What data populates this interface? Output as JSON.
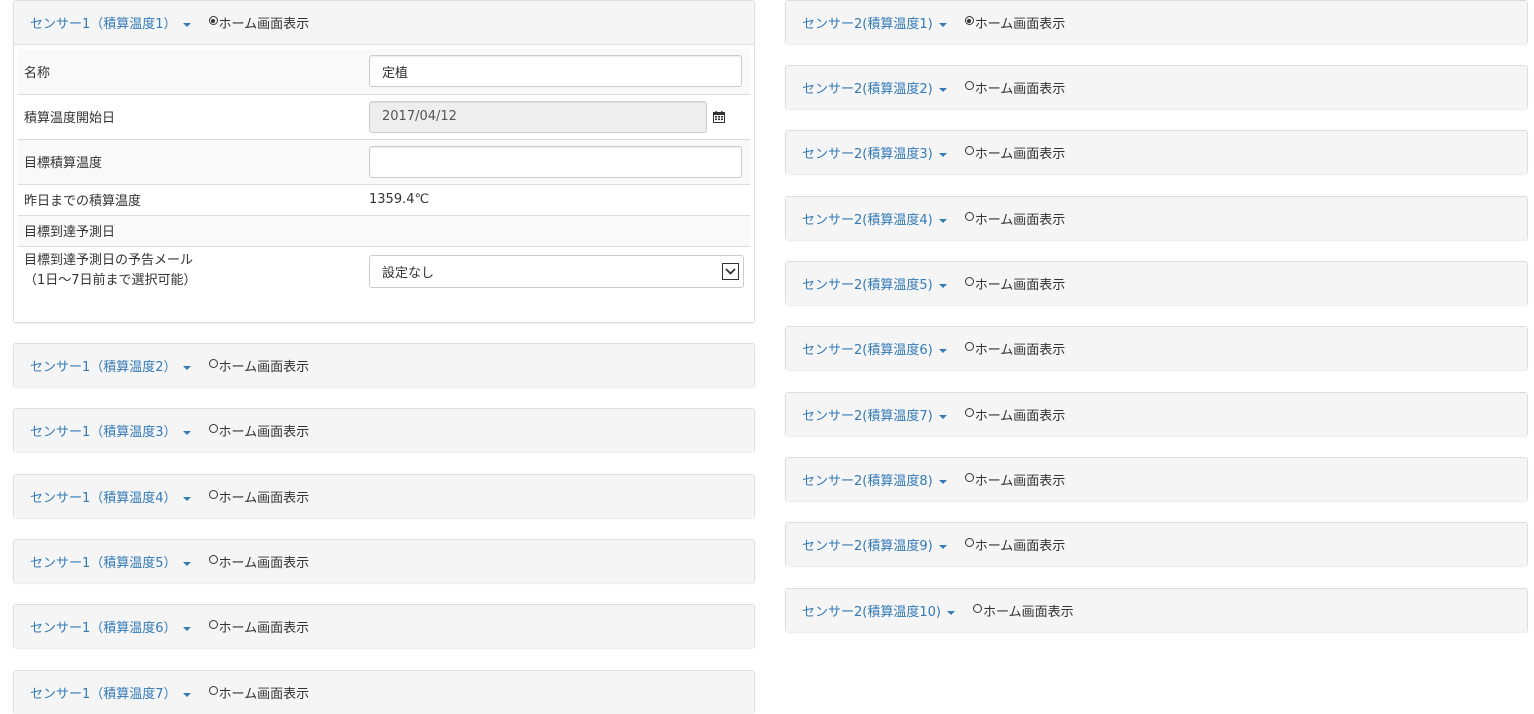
{
  "radio_label": "ホーム画面表示",
  "sensor1": {
    "panels": [
      {
        "title": "センサー1（積算温度1）",
        "checked": true
      },
      {
        "title": "センサー1（積算温度2）",
        "checked": false
      },
      {
        "title": "センサー1（積算温度3）",
        "checked": false
      },
      {
        "title": "センサー1（積算温度4）",
        "checked": false
      },
      {
        "title": "センサー1（積算温度5）",
        "checked": false
      },
      {
        "title": "センサー1（積算温度6）",
        "checked": false
      },
      {
        "title": "センサー1（積算温度7）",
        "checked": false
      }
    ]
  },
  "sensor2": {
    "panels": [
      {
        "title": "センサー2(積算温度1)",
        "checked": true
      },
      {
        "title": "センサー2(積算温度2)",
        "checked": false
      },
      {
        "title": "センサー2(積算温度3)",
        "checked": false
      },
      {
        "title": "センサー2(積算温度4)",
        "checked": false
      },
      {
        "title": "センサー2(積算温度5)",
        "checked": false
      },
      {
        "title": "センサー2(積算温度6)",
        "checked": false
      },
      {
        "title": "センサー2(積算温度7)",
        "checked": false
      },
      {
        "title": "センサー2(積算温度8)",
        "checked": false
      },
      {
        "title": "センサー2(積算温度9)",
        "checked": false
      },
      {
        "title": "センサー2(積算温度10)",
        "checked": false
      }
    ]
  },
  "form": {
    "name_label": "名称",
    "name_value": "定植",
    "start_label": "積算温度開始日",
    "start_value": "2017/04/12",
    "target_label": "目標積算温度",
    "target_value": "",
    "accum_label": "昨日までの積算温度",
    "accum_value": "1359.4℃",
    "reach_label": "目標到達予測日",
    "reach_value": "",
    "mail_label_1": "目標到達予測日の予告メール",
    "mail_label_2": "（1日〜7日前まで選択可能）",
    "mail_value": "設定なし"
  },
  "icons": {
    "calendar": "calendar-icon",
    "caret": "caret-down-icon",
    "select_arrow": "chevron-down-icon"
  }
}
